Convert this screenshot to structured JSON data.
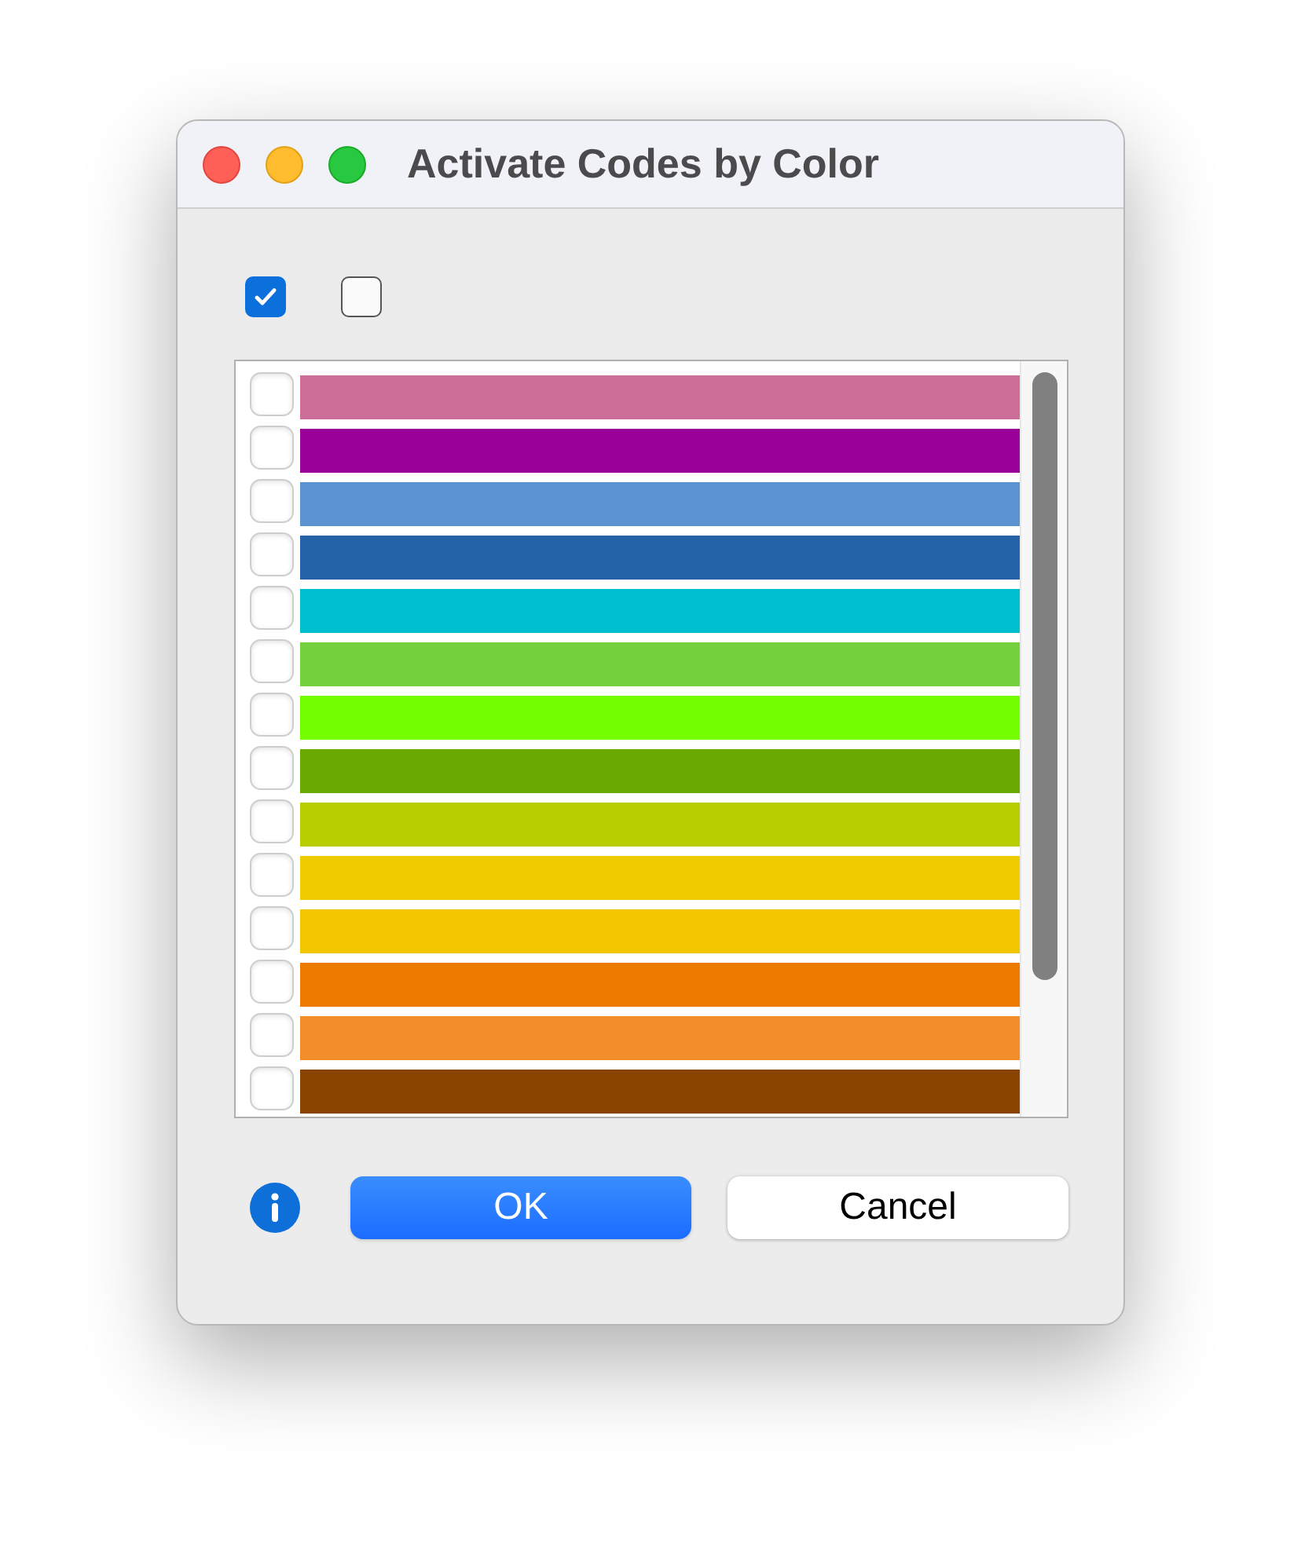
{
  "window": {
    "title": "Activate Codes by Color"
  },
  "header_checkboxes": [
    {
      "checked": true
    },
    {
      "checked": false
    }
  ],
  "rows": [
    {
      "checked": false,
      "color": "#cd6e98"
    },
    {
      "checked": false,
      "color": "#990099"
    },
    {
      "checked": false,
      "color": "#5b93d1"
    },
    {
      "checked": false,
      "color": "#2563a8"
    },
    {
      "checked": false,
      "color": "#00bfcf"
    },
    {
      "checked": false,
      "color": "#72d13d"
    },
    {
      "checked": false,
      "color": "#73ff00"
    },
    {
      "checked": false,
      "color": "#6aaa00"
    },
    {
      "checked": false,
      "color": "#b8ce00"
    },
    {
      "checked": false,
      "color": "#f0cb00"
    },
    {
      "checked": false,
      "color": "#f3c400"
    },
    {
      "checked": false,
      "color": "#ec7b00"
    },
    {
      "checked": false,
      "color": "#f18d2a"
    },
    {
      "checked": false,
      "color": "#8a4400"
    }
  ],
  "buttons": [
    {
      "label": "OK",
      "default": true
    },
    {
      "label": "Cancel",
      "default": false
    }
  ]
}
